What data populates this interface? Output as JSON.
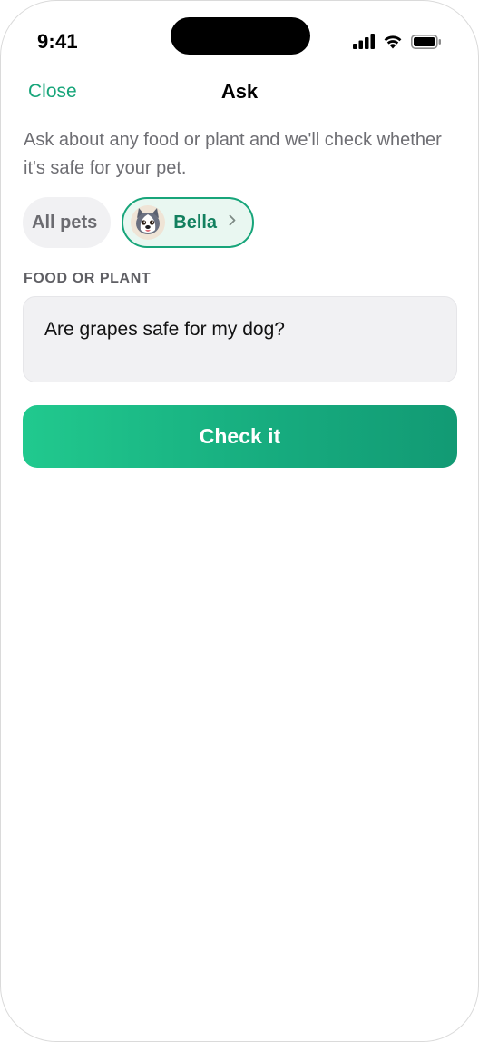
{
  "status_bar": {
    "time": "9:41",
    "icons": [
      "cellular-signal-icon",
      "wifi-icon",
      "battery-icon"
    ]
  },
  "nav": {
    "close_label": "Close",
    "title": "Ask"
  },
  "description": "Ask about any food or plant and we'll check whether it's safe for your pet.",
  "pets": {
    "all_label": "All pets",
    "selected_pet": {
      "name": "Bella",
      "avatar_icon": "husky-dog-avatar",
      "chevron_icon": "chevron-right-icon"
    }
  },
  "query": {
    "label": "FOOD OR PLANT",
    "value": "Are grapes safe for my dog?"
  },
  "action": {
    "label": "Check it"
  },
  "colors": {
    "accent": "#17a57a",
    "accent_dark": "#13805f",
    "chip_selected_bg": "#e9f7f1",
    "input_bg": "#f1f1f3",
    "button_gradient_start": "#21c98e",
    "button_gradient_end": "#129a74"
  }
}
